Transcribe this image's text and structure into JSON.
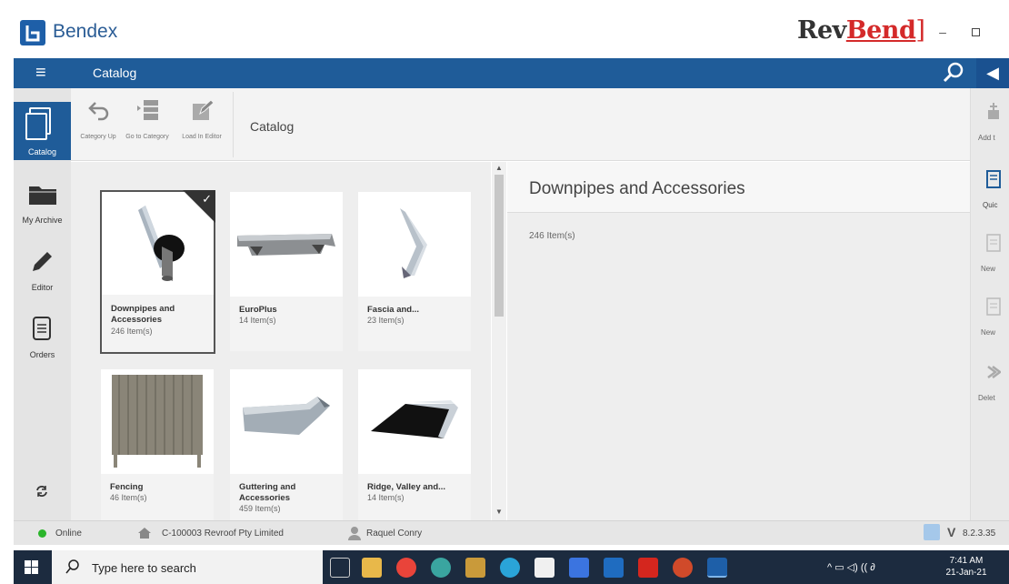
{
  "window": {
    "app_name": "Bendex",
    "brand": {
      "part1": "Rev",
      "part2": "Bend",
      "bracket": "]"
    },
    "minimize_symbol": "–"
  },
  "header": {
    "menu_symbol": "≡",
    "title": "Catalog",
    "collapse_symbol": "◀"
  },
  "left_nav": [
    {
      "label": "Catalog",
      "icon": "catalog-icon",
      "active": true
    },
    {
      "label": "My Archive",
      "icon": "folder-icon"
    },
    {
      "label": "Editor",
      "icon": "pencil-icon"
    },
    {
      "label": "Orders",
      "icon": "orders-icon"
    },
    {
      "label": "",
      "icon": "sync-icon"
    }
  ],
  "toolbar": {
    "buttons": [
      {
        "label": "Category Up",
        "icon": "undo-arrow-icon"
      },
      {
        "label": "Go to Category",
        "icon": "go-to-category-icon"
      },
      {
        "label": "Load In Editor",
        "icon": "load-editor-icon"
      }
    ],
    "title": "Catalog"
  },
  "catalog_items": [
    {
      "name": "Downpipes and Accessories",
      "count": "246 Item(s)",
      "selected": true
    },
    {
      "name": "EuroPlus",
      "count": "14 Item(s)"
    },
    {
      "name": "Fascia and...",
      "count": "23 Item(s)"
    },
    {
      "name": "Fencing",
      "count": "46 Item(s)"
    },
    {
      "name": "Guttering and Accessories",
      "count": "459 Item(s)"
    },
    {
      "name": "Ridge, Valley and...",
      "count": "14 Item(s)"
    }
  ],
  "scrollbar": {
    "up": "▲",
    "down": "▼"
  },
  "detail": {
    "title": "Downpipes and Accessories",
    "count": "246 Item(s)"
  },
  "right_panel": [
    {
      "label": "Add t",
      "icon": "add-to-icon"
    },
    {
      "label": "Quic",
      "icon": "quick-icon"
    },
    {
      "label": "New",
      "icon": "new-document-icon"
    },
    {
      "label": "New",
      "icon": "new-document-icon"
    },
    {
      "label": "Delet",
      "icon": "delete-icon"
    }
  ],
  "status": {
    "online": "Online",
    "company": "C-100003 Revroof Pty Limited",
    "user": "Raquel Conry",
    "v": "V",
    "version": "8.2.3.35"
  },
  "taskbar": {
    "search_placeholder": "Type here to search",
    "time": "7:41 AM",
    "date": "21-Jan-21",
    "tray": "^  ▭  ◁)  ((  ∂"
  },
  "colors": {
    "header_blue": "#1f5c99",
    "brand_red": "#d42a2a",
    "online_green": "#2bb52b"
  }
}
